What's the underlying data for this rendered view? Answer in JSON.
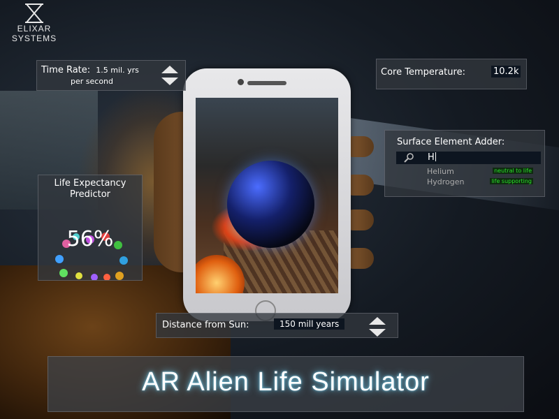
{
  "brand": {
    "line1": "ELIXAR",
    "line2": "SYSTEMS"
  },
  "time_rate": {
    "label": "Time Rate:",
    "value_line1": "1.5 mil. yrs",
    "value_line2": "per second"
  },
  "core_temperature": {
    "label": "Core Temperature:",
    "value": "10.2k"
  },
  "life_expectancy": {
    "label_line1": "Life Expectancy",
    "label_line2": "Predictor",
    "percent": "56%"
  },
  "surface_element_adder": {
    "label": "Surface Element Adder:",
    "query": "H",
    "suggestions": [
      {
        "name": "Helium",
        "tag": "neutral to life"
      },
      {
        "name": "Hydrogen",
        "tag": "life supporting"
      }
    ]
  },
  "distance": {
    "label": "Distance from Sun:",
    "value": "150 mill years"
  },
  "title": "AR Alien Life Simulator",
  "colors": {
    "accent_glow": "#78dcff",
    "tag_green": "#28e028",
    "panel": "#32373e"
  }
}
